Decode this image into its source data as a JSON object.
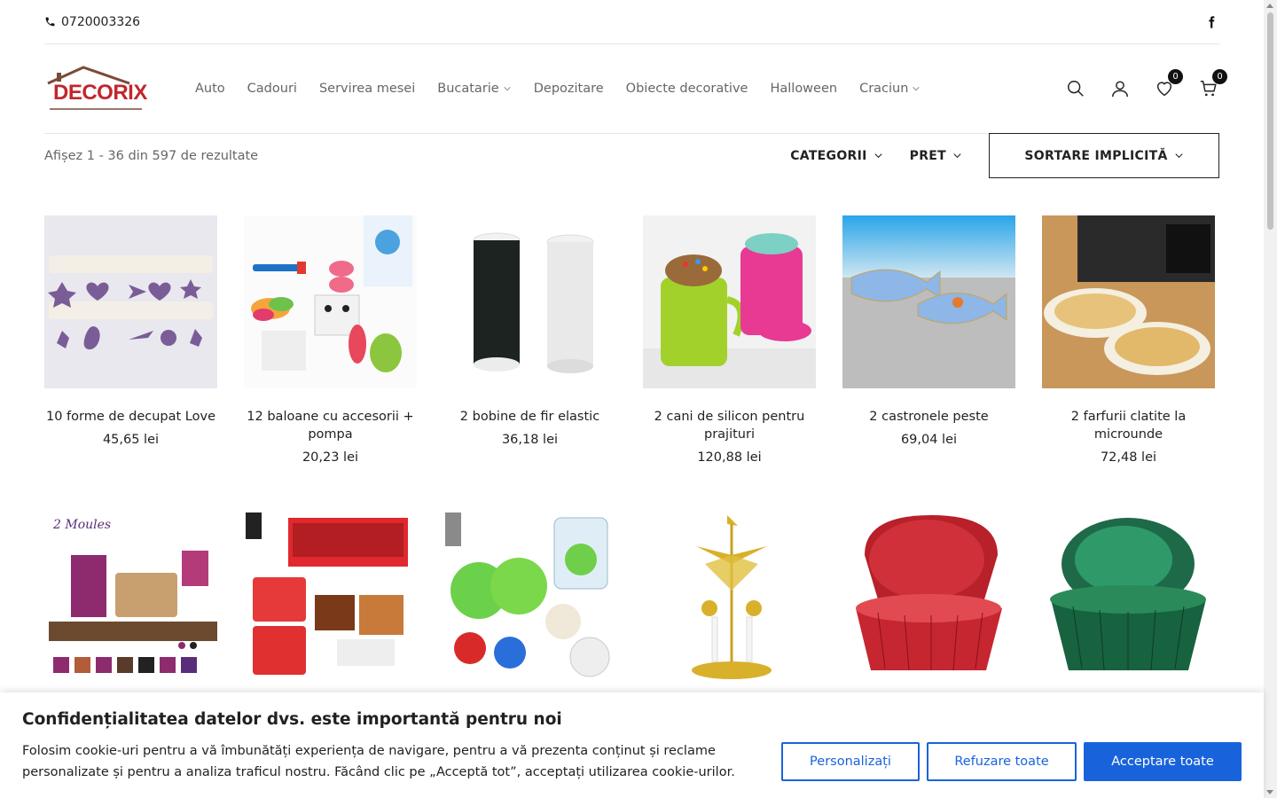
{
  "topbar": {
    "phone": "0720003326"
  },
  "header": {
    "logo_text": "DECORIX",
    "nav": [
      {
        "label": "Auto",
        "has_dropdown": false
      },
      {
        "label": "Cadouri",
        "has_dropdown": false
      },
      {
        "label": "Servirea mesei",
        "has_dropdown": false
      },
      {
        "label": "Bucatarie",
        "has_dropdown": true
      },
      {
        "label": "Depozitare",
        "has_dropdown": false
      },
      {
        "label": "Obiecte decorative",
        "has_dropdown": false
      },
      {
        "label": "Halloween",
        "has_dropdown": false
      },
      {
        "label": "Craciun",
        "has_dropdown": true
      }
    ],
    "wishlist_count": "0",
    "cart_count": "0"
  },
  "toolbar": {
    "result_count": "Afișez 1 - 36 din 597 de rezultate",
    "filter_categories": "CATEGORII",
    "filter_price": "PRET",
    "sort_label": "SORTARE IMPLICITĂ"
  },
  "products": [
    {
      "name": "10 forme de decupat Love",
      "price": "45,65 lei"
    },
    {
      "name": "12 baloane cu accesorii + pompa",
      "price": "20,23 lei"
    },
    {
      "name": "2 bobine de fir elastic",
      "price": "36,18 lei"
    },
    {
      "name": "2 cani de silicon pentru prajituri",
      "price": "120,88 lei"
    },
    {
      "name": "2 castronele peste",
      "price": "69,04 lei"
    },
    {
      "name": "2 farfurii clatite la microunde",
      "price": "72,48 lei"
    }
  ],
  "cookie": {
    "title": "Confidențialitatea datelor dvs. este importantă pentru noi",
    "text": "Folosim cookie-uri pentru a vă îmbunătăți experiența de navigare, pentru a vă prezenta conținut și reclame personalizate și pentru a analiza traficul nostru. Făcând clic pe „Acceptă tot”, acceptați utilizarea cookie-urilor.",
    "customize": "Personalizați",
    "reject": "Refuzare toate",
    "accept": "Acceptare toate"
  },
  "colors": {
    "accent": "#1863dc",
    "logo_red": "#c0272d",
    "logo_brown": "#7a4a3a"
  }
}
